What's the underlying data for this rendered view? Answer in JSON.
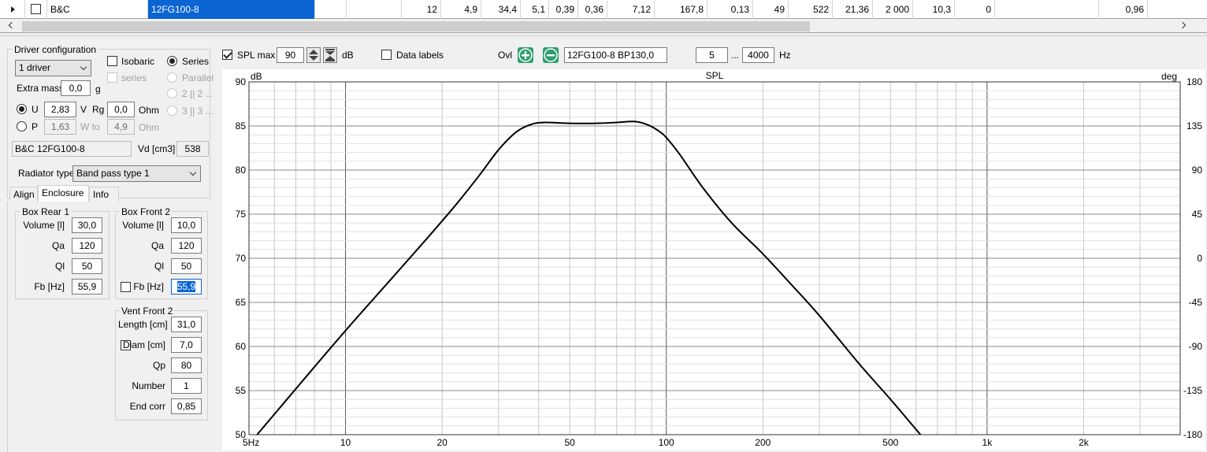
{
  "grid": {
    "brand": "B&C",
    "model": "12FG100-8",
    "cells": [
      "12",
      "4,9",
      "34,4",
      "5,1",
      "0,39",
      "0,36",
      "7,12",
      "167,8",
      "0,13",
      "49",
      "522",
      "21,36",
      "2 000",
      "10,3",
      "0",
      "",
      "0,96"
    ]
  },
  "driver_config": {
    "title": "Driver configuration",
    "count": "1 driver",
    "isobaric": "Isobaric",
    "series_check": "series",
    "series_radio": "Series",
    "parallel": "Parallel",
    "opt2": "2 || 2 ...",
    "opt3": "3 || 3 ...",
    "extra_mass_label": "Extra mass",
    "extra_mass": "0,0",
    "extra_mass_unit": "g",
    "u_label": "U",
    "u_value": "2,83",
    "u_unit": "V",
    "rg_label": "Rg",
    "rg_value": "0,0",
    "rg_unit": "Ohm",
    "p_label": "P",
    "p_value": "1,63",
    "wto_label": "W to",
    "wto_value": "4,9",
    "wto_unit": "Ohm",
    "driver_name": "B&C 12FG100-8",
    "vd_label": "Vd [cm3]",
    "vd_value": "538"
  },
  "radiator": {
    "label": "Radiator type",
    "value": "Band pass type 1"
  },
  "tabs": [
    "Align",
    "Enclosure",
    "Info"
  ],
  "box_rear": {
    "title": "Box Rear 1",
    "fields": [
      {
        "label": "Volume [l]",
        "value": "30,0"
      },
      {
        "label": "Qa",
        "value": "120"
      },
      {
        "label": "Ql",
        "value": "50"
      },
      {
        "label": "Fb [Hz]",
        "value": "55,9"
      }
    ]
  },
  "box_front": {
    "title": "Box Front 2",
    "fields": [
      {
        "label": "Volume [l]",
        "value": "10,0"
      },
      {
        "label": "Qa",
        "value": "120"
      },
      {
        "label": "Ql",
        "value": "50"
      },
      {
        "label": "Fb [Hz]",
        "value": "55,9"
      }
    ]
  },
  "vent_front": {
    "title": "Vent Front 2",
    "fields": [
      {
        "label": "Length [cm]",
        "value": "31,0"
      },
      {
        "label": "Diam [cm]",
        "value": "7,0"
      },
      {
        "label": "Qp",
        "value": "80"
      },
      {
        "label": "Number",
        "value": "1"
      },
      {
        "label": "End corr",
        "value": "0,85"
      }
    ]
  },
  "toolbar": {
    "spl_max_label": "SPL max",
    "spl_max": "90",
    "db": "dB",
    "data_labels": "Data labels",
    "ovl": "Ovl",
    "curve_name": "12FG100-8 BP130,0",
    "f_from": "5",
    "dots": "...",
    "f_to": "4000",
    "hz": "Hz"
  },
  "colors": {
    "add": "#2e9e6e",
    "remove": "#2e9e6e",
    "selection": "#0a64d2"
  },
  "chart_data": {
    "type": "line",
    "title": "SPL",
    "ylabel": "dB",
    "y2label": "deg",
    "xscale": "log",
    "xlim": [
      5,
      4000
    ],
    "ylim": [
      50,
      90
    ],
    "y2lim": [
      -180,
      180
    ],
    "xticks": [
      {
        "v": 5,
        "t": "5Hz"
      },
      {
        "v": 10,
        "t": "10"
      },
      {
        "v": 20,
        "t": "20"
      },
      {
        "v": 50,
        "t": "50"
      },
      {
        "v": 100,
        "t": "100"
      },
      {
        "v": 200,
        "t": "200"
      },
      {
        "v": 500,
        "t": "500"
      },
      {
        "v": 1000,
        "t": "1k"
      },
      {
        "v": 2000,
        "t": "2k"
      }
    ],
    "yticks": [
      50,
      55,
      60,
      65,
      70,
      75,
      80,
      85,
      90
    ],
    "y2ticks": [
      "-180",
      "-135",
      "-90",
      "-45",
      "0",
      "45",
      "90",
      "135",
      "180"
    ],
    "grid": true,
    "series": [
      {
        "x": [
          5.3,
          7,
          10,
          14,
          18,
          22,
          26,
          30,
          34,
          38,
          42,
          50,
          60,
          70,
          80,
          88,
          95,
          100,
          110,
          130,
          160,
          200,
          250,
          300,
          400,
          500,
          620
        ],
        "y": [
          50,
          55.2,
          61.8,
          67.8,
          72.3,
          76.0,
          79.3,
          82.3,
          84.3,
          85.2,
          85.4,
          85.3,
          85.3,
          85.4,
          85.5,
          85.1,
          84.4,
          83.7,
          81.8,
          78.0,
          74.0,
          70.5,
          66.7,
          63.5,
          58.0,
          54.0,
          50
        ]
      }
    ]
  }
}
